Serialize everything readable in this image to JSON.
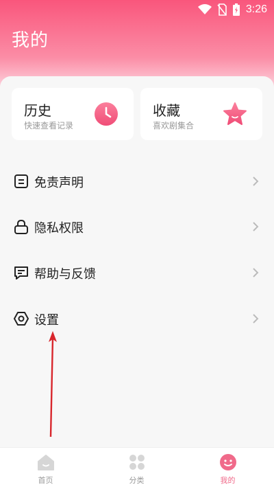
{
  "status_bar": {
    "time": "3:26"
  },
  "header": {
    "title": "我的"
  },
  "cards": [
    {
      "title": "历史",
      "subtitle": "快速查看记录"
    },
    {
      "title": "收藏",
      "subtitle": "喜欢剧集合"
    }
  ],
  "menu": [
    {
      "label": "免责声明",
      "icon": "document-icon"
    },
    {
      "label": "隐私权限",
      "icon": "lock-icon"
    },
    {
      "label": "帮助与反馈",
      "icon": "chat-feedback-icon"
    },
    {
      "label": "设置",
      "icon": "hexagon-settings-icon"
    }
  ],
  "tabbar": {
    "items": [
      {
        "label": "首页",
        "icon": "home-icon",
        "active": false
      },
      {
        "label": "分类",
        "icon": "grid-icon",
        "active": false
      },
      {
        "label": "我的",
        "icon": "smiley-icon",
        "active": true
      }
    ]
  },
  "colors": {
    "accent": "#f06a8a",
    "header_top": "#f9567c"
  }
}
